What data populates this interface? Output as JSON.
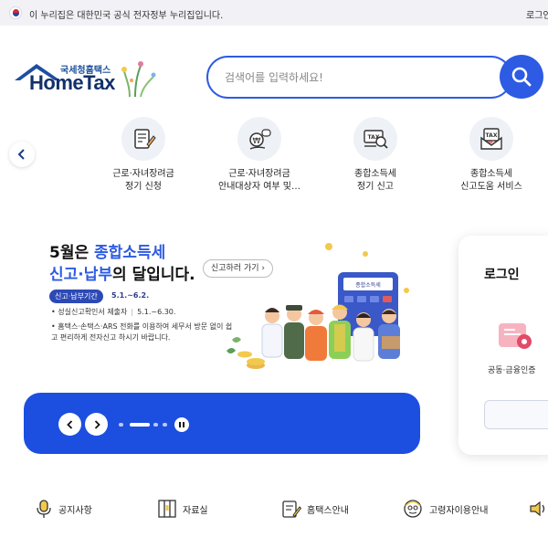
{
  "gov_bar": {
    "text": "이 누리집은 대한민국 공식 전자정부 누리집입니다.",
    "login_label": "로그인"
  },
  "logo": {
    "korean": "국세청홈택스",
    "english": "HomeTax"
  },
  "search": {
    "placeholder": "검색어를 입력하세요!",
    "value": ""
  },
  "quick_menu": [
    {
      "label_line1": "근로·자녀장려금",
      "label_line2": "정기 신청",
      "icon": "document-pen-icon"
    },
    {
      "label_line1": "근로·자녀장려금",
      "label_line2": "안내대상자 여부 및…",
      "icon": "won-hand-icon"
    },
    {
      "label_line1": "종합소득세",
      "label_line2": "정기 신고",
      "icon": "tax-magnifier-icon"
    },
    {
      "label_line1": "종합소득세",
      "label_line2": "신고도움 서비스",
      "icon": "tax-envelope-icon"
    }
  ],
  "banner": {
    "headline_prefix": "5월은 ",
    "headline_highlight": "종합소득세",
    "headline2_highlight": "신고·납부",
    "headline2_suffix": "의 달입니다.",
    "cta_label": "신고하러 가기",
    "period_badge": "신고·납부기간",
    "period_value": "5.1.~6.2.",
    "line2_prefix": "• 성실신고확인서 제출자",
    "line2_value": "5.1.~6.30.",
    "line3": "• 홈택스·손택스·ARS 전화를 이용하여 세무서 방문 없이 쉽고 편리하게 전자신고 하시기 바랍니다.",
    "calculator_label": "종합소득세"
  },
  "login_card": {
    "title": "로그인",
    "cert_label": "공동·금융인증"
  },
  "bottom_nav": [
    {
      "label": "공지사항",
      "icon": "microphone-icon"
    },
    {
      "label": "자료실",
      "icon": "bookshelf-icon"
    },
    {
      "label": "홈택스안내",
      "icon": "document-edit-icon"
    },
    {
      "label": "고령자이용안내",
      "icon": "elderly-icon"
    }
  ],
  "colors": {
    "primary_blue": "#2d5be3",
    "banner_bar": "#1c4fe0",
    "navy": "#13306b"
  }
}
